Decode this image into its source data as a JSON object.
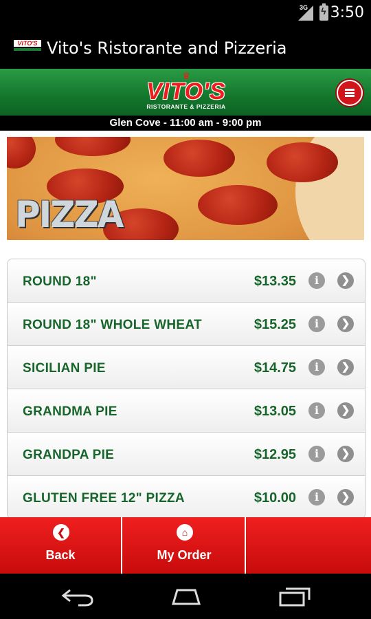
{
  "status_bar": {
    "network_label": "3G",
    "time": "3:50",
    "icons": [
      "signal-icon",
      "battery-charging-icon"
    ]
  },
  "action_bar": {
    "app_icon_text": "VITO'S",
    "title": "Vito's Ristorante and Pizzeria"
  },
  "header": {
    "logo_text": "VITO'S",
    "logo_subtext": "RISTORANTE & PIZZERIA",
    "hours": "Glen Cove - 11:00 am - 9:00 pm",
    "menu_icon": "hamburger-menu-icon",
    "colors": {
      "green": "#13762c",
      "red": "#d1151a"
    }
  },
  "banner": {
    "label": "PIZZA"
  },
  "menu_items": [
    {
      "name": "ROUND 18\"",
      "price": "$13.35"
    },
    {
      "name": "ROUND 18\" WHOLE WHEAT",
      "price": "$15.25"
    },
    {
      "name": "SICILIAN PIE",
      "price": "$14.75"
    },
    {
      "name": "GRANDMA PIE",
      "price": "$13.05"
    },
    {
      "name": "GRANDPA PIE",
      "price": "$12.95"
    },
    {
      "name": "GLUTEN FREE 12\" PIZZA",
      "price": "$10.00"
    }
  ],
  "item_icons": {
    "info": "info-icon",
    "go": "chevron-right-icon"
  },
  "tab_bar": {
    "back_label": "Back",
    "my_order_label": "My Order"
  }
}
